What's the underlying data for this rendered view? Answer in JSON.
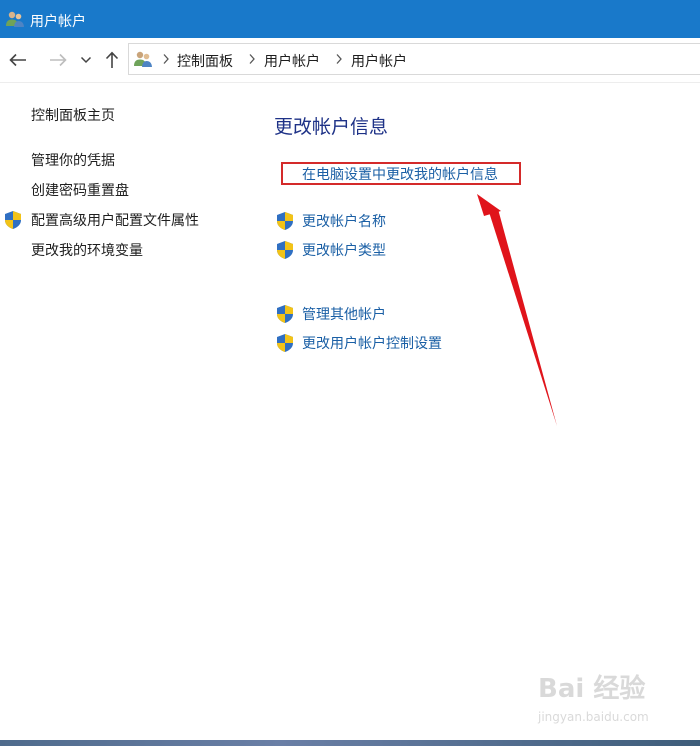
{
  "window": {
    "title": "用户帐户"
  },
  "address": {
    "breadcrumbs": [
      "控制面板",
      "用户帐户",
      "用户帐户"
    ]
  },
  "left_pane": {
    "home_link": "控制面板主页",
    "links": [
      "管理你的凭据",
      "创建密码重置盘",
      "配置高级用户配置文件属性",
      "更改我的环境变量"
    ]
  },
  "main": {
    "heading": "更改帐户信息",
    "pc_settings_link": "在电脑设置中更改我的帐户信息",
    "links": [
      "更改帐户名称",
      "更改帐户类型"
    ],
    "other_links": [
      "管理其他帐户",
      "更改用户帐户控制设置"
    ]
  },
  "watermark": {
    "text": "Bai 经验",
    "sub": "jingyan.baidu.com"
  },
  "colors": {
    "titlebar": "#1979ca",
    "link": "#1a5fa5",
    "heading": "#1e3287",
    "highlight": "#d42a2a"
  }
}
